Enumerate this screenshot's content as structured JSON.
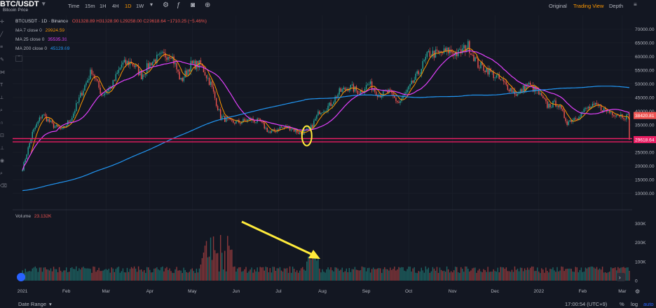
{
  "header": {
    "symbol": "BTC/USDT",
    "subtitle": "Bitcoin Price",
    "timeframes": [
      "Time",
      "15m",
      "1H",
      "4H",
      "1D",
      "1W"
    ],
    "active_timeframe": "1D",
    "views": [
      "Original",
      "Trading View",
      "Depth"
    ],
    "active_view": "Trading View"
  },
  "legend": {
    "ohlc_line": {
      "label": "BTCUSDT · 1D · Binance",
      "values": "O31328.89 H31328.90 L29258.00 C29618.64 −1710.25 (−5.46%)"
    },
    "ma7": {
      "label": "MA 7 close 0",
      "value": "29924.59",
      "color": "#ff9800"
    },
    "ma25": {
      "label": "MA 25 close 0",
      "value": "35535.31",
      "color": "#e040fb"
    },
    "ma200": {
      "label": "MA 200 close 0",
      "value": "45129.69",
      "color": "#2196f3"
    },
    "volume_label": "Volume",
    "volume_value": "23.132K"
  },
  "price_axis": {
    "ticks": [
      "70000.00",
      "65000.00",
      "60000.00",
      "55000.00",
      "50000.00",
      "45000.00",
      "40000.00",
      "35000.00",
      "30000.00",
      "25000.00",
      "20000.00",
      "15000.00",
      "10000.00"
    ],
    "badge_upper": "38420.81",
    "badge_lower": "29618.64"
  },
  "volume_axis": {
    "ticks": [
      "300K",
      "200K",
      "100K",
      "0"
    ]
  },
  "time_axis": {
    "ticks": [
      "2021",
      "Feb",
      "Mar",
      "Apr",
      "May",
      "Jun",
      "Jul",
      "Aug",
      "Sep",
      "Oct",
      "Nov",
      "Dec",
      "2022",
      "Feb",
      "Mar"
    ]
  },
  "footer": {
    "date_range": "Date Range",
    "clock": "17:00:54 (UTC+9)",
    "pct": "%",
    "log": "log",
    "auto": "auto"
  },
  "colors": {
    "background": "#131722",
    "up": "#26a69a",
    "down": "#ef5350",
    "ma7": "#ff9800",
    "ma25": "#e040fb",
    "ma200": "#2196f3",
    "support": "#e91e63",
    "highlight": "#ffeb3b"
  },
  "icons": [
    "settings-icon",
    "indicator-icon",
    "camera-icon",
    "plus-icon",
    "arrow-right-icon",
    "eye-icon",
    "gear-icon"
  ],
  "chart_data": {
    "type": "candlestick",
    "title": "BTCUSDT · 1D · Binance",
    "ylim": [
      5000,
      75000
    ],
    "ohlc_sparse_dates": [
      "2021-01-01",
      "2021-01-08",
      "2021-01-15",
      "2021-01-22",
      "2021-01-29",
      "2021-02-05",
      "2021-02-12",
      "2021-02-19",
      "2021-02-26",
      "2021-03-05",
      "2021-03-12",
      "2021-03-19",
      "2021-03-26",
      "2021-04-02",
      "2021-04-09",
      "2021-04-16",
      "2021-04-23",
      "2021-04-30",
      "2021-05-07",
      "2021-05-14",
      "2021-05-21",
      "2021-05-28",
      "2021-06-04",
      "2021-06-11",
      "2021-06-18",
      "2021-06-25",
      "2021-07-02",
      "2021-07-09",
      "2021-07-16",
      "2021-07-23",
      "2021-07-30",
      "2021-08-06",
      "2021-08-13",
      "2021-08-20",
      "2021-08-27",
      "2021-09-03",
      "2021-09-10",
      "2021-09-17",
      "2021-09-24",
      "2021-10-01",
      "2021-10-08",
      "2021-10-15",
      "2021-10-22",
      "2021-10-29",
      "2021-11-05",
      "2021-11-12",
      "2021-11-19",
      "2021-11-26",
      "2021-12-03",
      "2021-12-10",
      "2021-12-17",
      "2021-12-24",
      "2021-12-31",
      "2022-01-07",
      "2022-01-14",
      "2022-01-21",
      "2022-01-28",
      "2022-02-04",
      "2022-02-11",
      "2022-02-18",
      "2022-02-25",
      "2022-03-04",
      "2022-03-06"
    ],
    "close_sparse": [
      19000,
      32000,
      39000,
      35000,
      33000,
      38000,
      47000,
      55000,
      46000,
      49000,
      57000,
      58000,
      53000,
      58000,
      60000,
      61000,
      51000,
      57000,
      57000,
      50000,
      38000,
      36000,
      36000,
      37000,
      36000,
      32000,
      34000,
      34000,
      32000,
      33000,
      40000,
      42000,
      47000,
      49000,
      47000,
      50000,
      46000,
      47000,
      43000,
      48000,
      54000,
      61000,
      61000,
      62000,
      61000,
      64000,
      57000,
      55000,
      52000,
      49000,
      46000,
      50000,
      47000,
      42000,
      43000,
      36000,
      38000,
      41000,
      42000,
      40000,
      39000,
      38000,
      38400
    ],
    "ma7_last": 29924.59,
    "ma25_last": 35535.31,
    "ma200_last": 45129.69,
    "last_close": 29618.64,
    "horizontal_lines": [
      30000,
      28800
    ],
    "annotation": "yellow ellipse at late-July 2021 low; yellow arrow pointing to volume spike"
  }
}
